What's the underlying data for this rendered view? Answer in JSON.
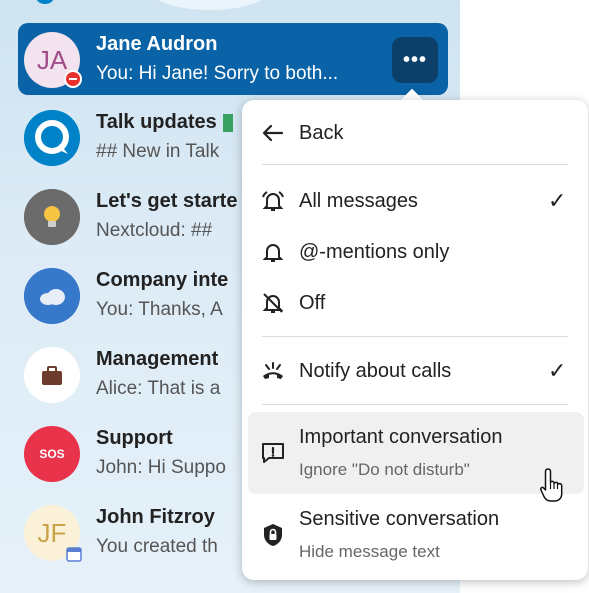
{
  "conversations": [
    {
      "title": "Jane Audron",
      "subtitle": "You: Hi Jane! Sorry to both...",
      "initials": "JA"
    },
    {
      "title": "Talk updates",
      "subtitle": "## New in Talk"
    },
    {
      "title": "Let's get starte",
      "subtitle": "Nextcloud: ##"
    },
    {
      "title": "Company inte",
      "subtitle": "You: Thanks, A"
    },
    {
      "title": "Management",
      "subtitle": "Alice: That is a"
    },
    {
      "title": "Support",
      "subtitle": "John: Hi Suppo",
      "avatar_text": "SOS"
    },
    {
      "title": "John Fitzroy",
      "subtitle": "You created th",
      "initials": "JF"
    }
  ],
  "menu": {
    "back": "Back",
    "all_messages": "All messages",
    "mentions_only": "@-mentions only",
    "off": "Off",
    "notify_calls": "Notify about calls",
    "important": {
      "label": "Important conversation",
      "sub": "Ignore \"Do not disturb\""
    },
    "sensitive": {
      "label": "Sensitive conversation",
      "sub": "Hide message text"
    },
    "checkmark": "✓"
  },
  "more_button_label": "•••",
  "colors": {
    "active_row": "#0a63a6",
    "more_button": "#0c3f6a",
    "status_dnd": "#e9322d",
    "support_avatar": "#e9334a",
    "nextcloud_blue": "#0082c9"
  }
}
